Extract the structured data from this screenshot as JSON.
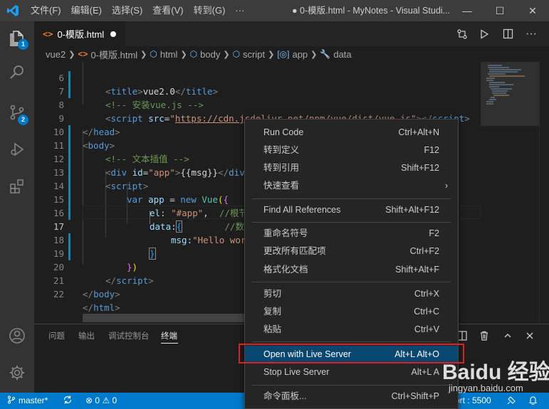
{
  "titlebar": {
    "menu": [
      "文件(F)",
      "编辑(E)",
      "选择(S)",
      "查看(V)",
      "转到(G)",
      "···"
    ],
    "title": "● 0-模版.html - MyNotes - Visual Studi...",
    "minimize": "—",
    "maximize": "☐",
    "close": "✕"
  },
  "activitybar": {
    "explorer_badge": "1",
    "scm_badge": "2"
  },
  "tab": {
    "icon": "<>",
    "label": "0-模版.html"
  },
  "breadcrumb": {
    "items": [
      "vue2",
      "0-模版.html",
      "html",
      "body",
      "script",
      "app",
      "data"
    ]
  },
  "editor": {
    "lines": [
      {
        "n": "6"
      },
      {
        "n": "7"
      },
      {
        "n": "8"
      },
      {
        "n": "9"
      },
      {
        "n": "10"
      },
      {
        "n": "11"
      },
      {
        "n": "12"
      },
      {
        "n": "13"
      },
      {
        "n": "14"
      },
      {
        "n": "15"
      },
      {
        "n": "16"
      },
      {
        "n": "17"
      },
      {
        "n": "18"
      },
      {
        "n": "19"
      },
      {
        "n": "20"
      },
      {
        "n": "21"
      },
      {
        "n": "22"
      }
    ],
    "code": {
      "l6_title": "vue2.0",
      "l7_comment": "<!-- 安装vue.js -->",
      "l8_url": "https://cdn.jsdelivr.net/npm/vue/dist/vue.js",
      "l11_comment": "<!-- 文本插值 -->",
      "l12_id": "\"app\"",
      "l12_msg": "{{msg}}",
      "l14_var": "var",
      "l14_name": "app",
      "l14_new": "new",
      "l14_vue": "Vue",
      "l15_key": "el:",
      "l15_val": "\"#app\"",
      "l15_comment": "//根节",
      "l16_key": "data:",
      "l16_comment": "//数据",
      "l17_key": "msg:",
      "l17_val": "\"Hello wor"
    }
  },
  "panel": {
    "tabs": [
      "问题",
      "输出",
      "调试控制台",
      "终端"
    ],
    "active": "终端"
  },
  "statusbar": {
    "branch": "master*",
    "errors": "0",
    "warnings": "0",
    "port": "Port : 5500"
  },
  "context_menu": {
    "items": [
      {
        "label": "Run Code",
        "key": "Ctrl+Alt+N"
      },
      {
        "label": "转到定义",
        "key": "F12"
      },
      {
        "label": "转到引用",
        "key": "Shift+F12"
      },
      {
        "label": "快速查看",
        "key": ""
      },
      {
        "label": "Find All References",
        "key": "Shift+Alt+F12"
      },
      {
        "label": "重命名符号",
        "key": "F2"
      },
      {
        "label": "更改所有匹配项",
        "key": "Ctrl+F2"
      },
      {
        "label": "格式化文档",
        "key": "Shift+Alt+F"
      },
      {
        "label": "剪切",
        "key": "Ctrl+X"
      },
      {
        "label": "复制",
        "key": "Ctrl+C"
      },
      {
        "label": "粘贴",
        "key": "Ctrl+V"
      },
      {
        "label": "Open with Live Server",
        "key": "Alt+L Alt+O"
      },
      {
        "label": "Stop Live Server",
        "key": "Alt+L A"
      },
      {
        "label": "命令面板...",
        "key": "Ctrl+Shift+P"
      }
    ],
    "submenu_arrow": "›"
  },
  "watermark": {
    "text": "Baidu 经验",
    "sub": "jingyan.baidu.com"
  },
  "colors": {
    "accent": "#007acc",
    "highlight_box": "#e02020",
    "menu_highlight": "#094771"
  }
}
